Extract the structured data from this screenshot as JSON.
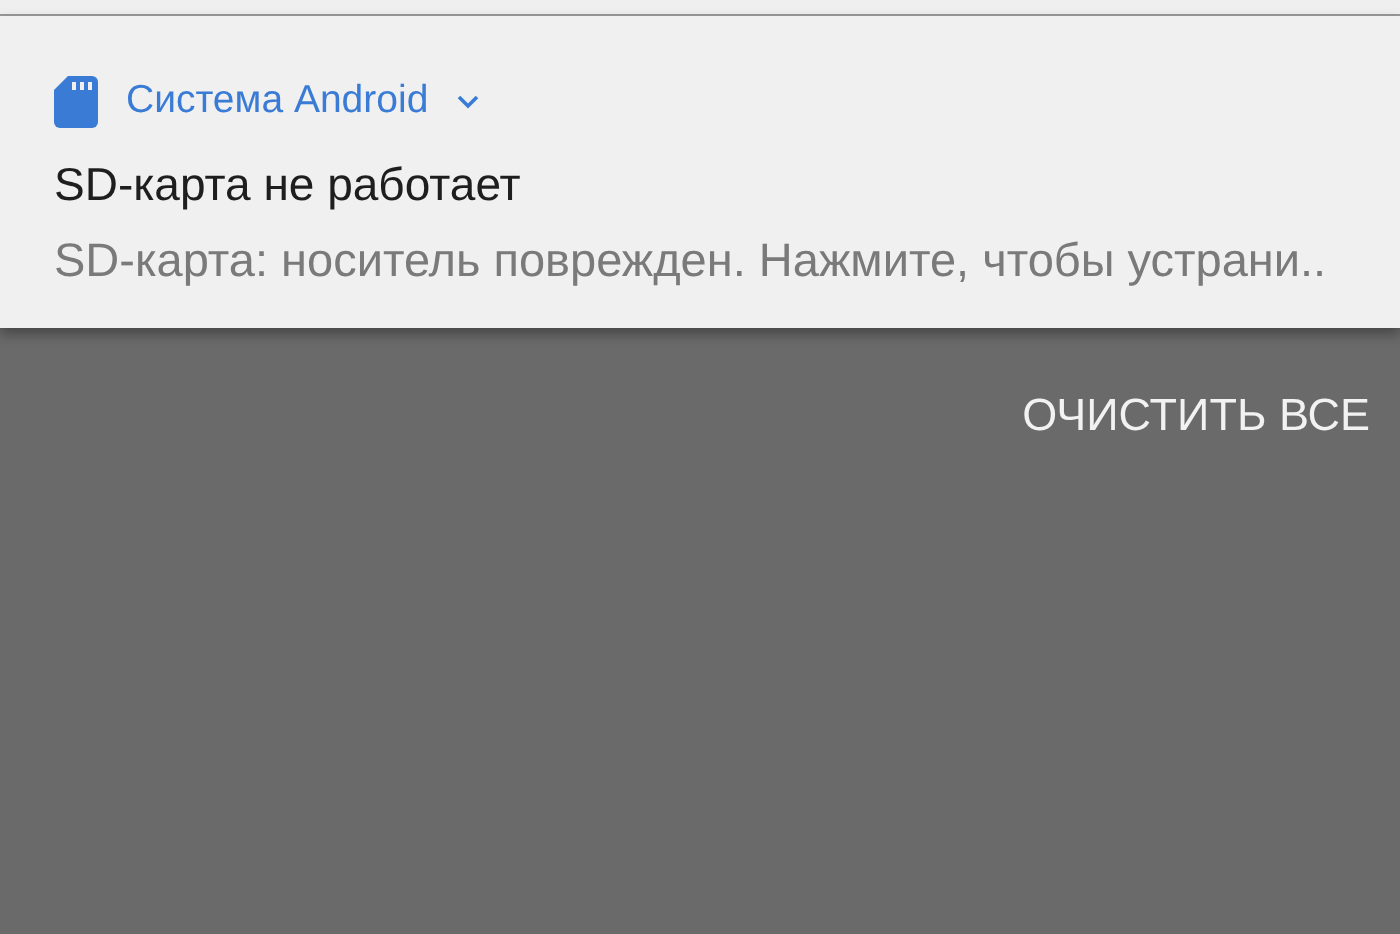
{
  "notification": {
    "app_name": "Система Android",
    "expanded": false,
    "title": "SD-карта не работает",
    "text": "SD-карта: носитель поврежден. Нажмите, чтобы устрани.."
  },
  "clear_all_button": "ОЧИСТИТЬ ВСЕ"
}
